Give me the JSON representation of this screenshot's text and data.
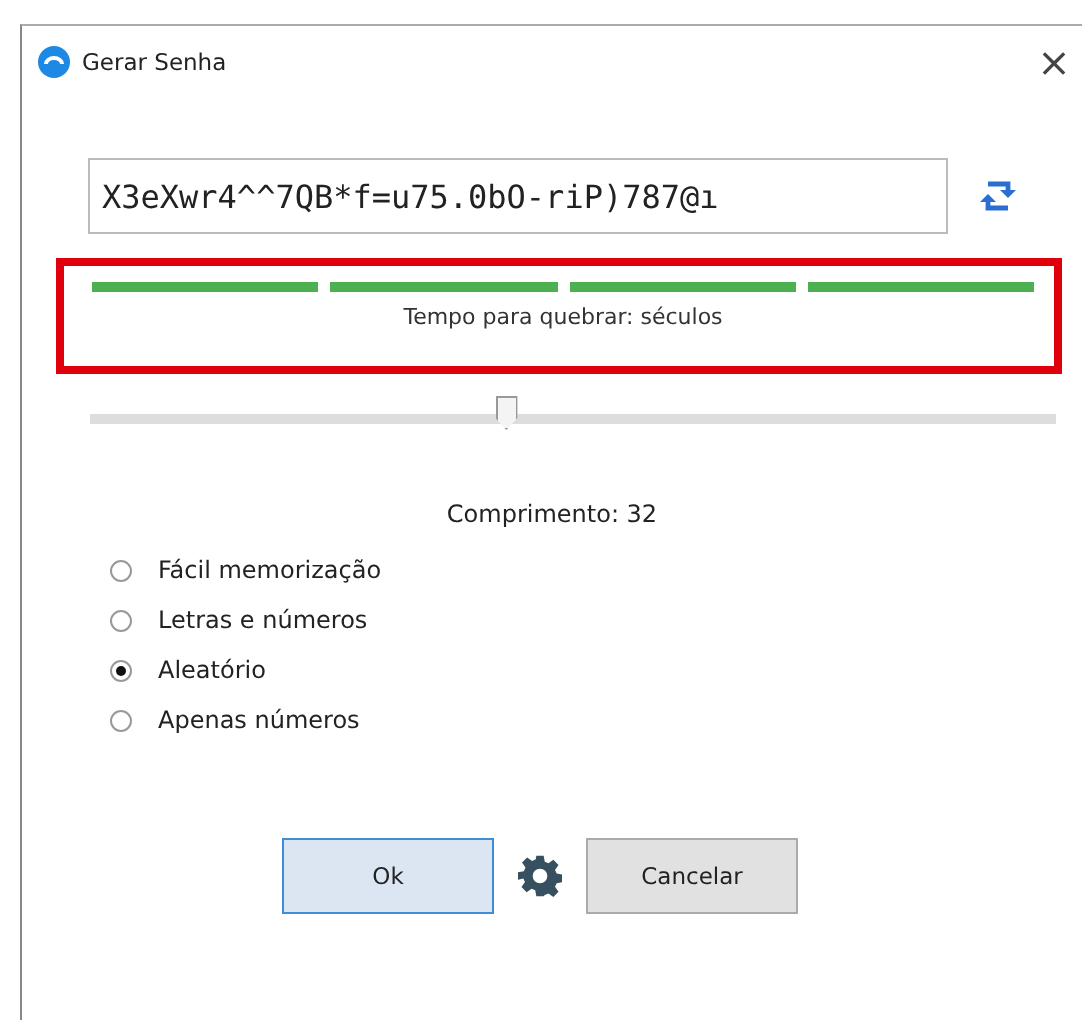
{
  "window": {
    "title": "Gerar Senha",
    "close": "×"
  },
  "password": {
    "value": "X3eXwr4^^7QB*f=u75.0bO-riP)787@ı"
  },
  "strength": {
    "segments": [
      {
        "filled": true
      },
      {
        "filled": true
      },
      {
        "filled": true
      },
      {
        "filled": true
      }
    ],
    "highlighted": true,
    "text": "Tempo para quebrar: séculos"
  },
  "length": {
    "level": 0.43,
    "label": "Comprimento: 32"
  },
  "options": [
    {
      "label": "Fácil memorização",
      "selected": false
    },
    {
      "label": "Letras e números",
      "selected": false
    },
    {
      "label": "Aleatório",
      "selected": true
    },
    {
      "label": "Apenas números",
      "selected": false
    }
  ],
  "buttons": [
    {
      "label": "Ok",
      "kind": "default"
    },
    {
      "label": "Cancelar",
      "kind": "normal"
    }
  ]
}
